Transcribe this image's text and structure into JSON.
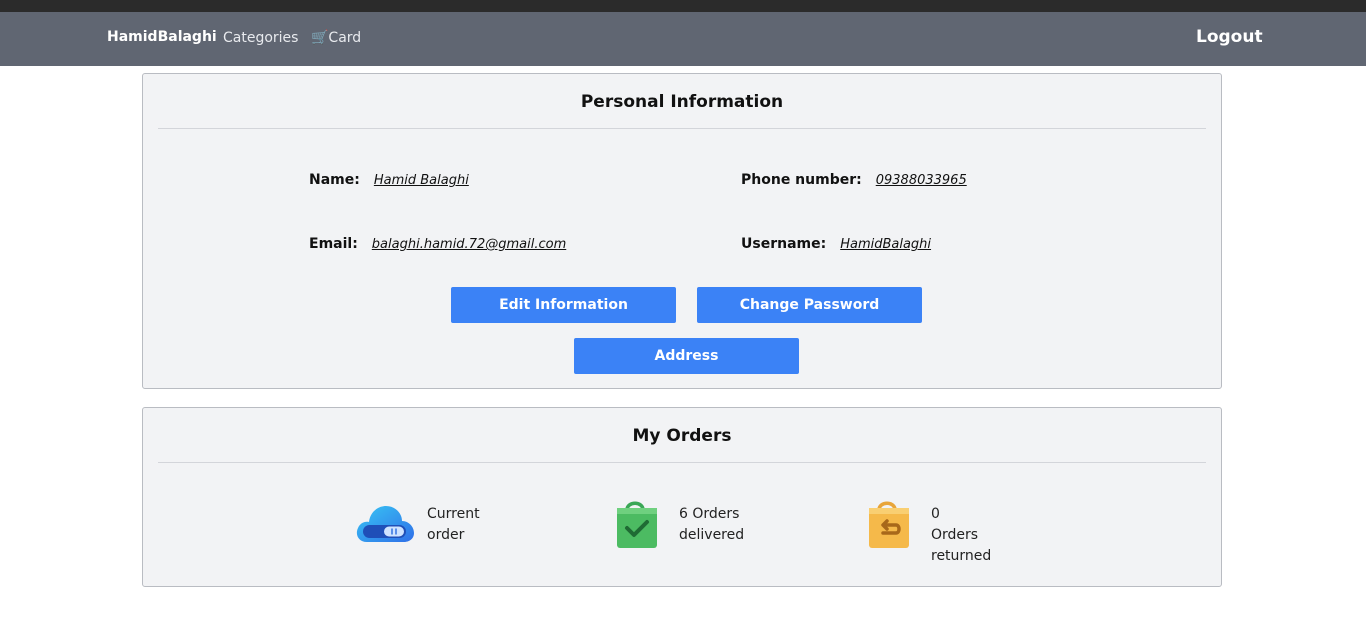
{
  "navbar": {
    "brand": "HamidBalaghi",
    "categories": "Categories",
    "card": "🛒Card",
    "logout": "Logout"
  },
  "personal": {
    "title": "Personal Information",
    "name_label": "Name:",
    "name_value": "Hamid Balaghi",
    "phone_label": "Phone number:",
    "phone_value": "09388033965",
    "email_label": "Email:",
    "email_value": "balaghi.hamid.72@gmail.com",
    "username_label": "Username:",
    "username_value": "HamidBalaghi",
    "edit_button": "Edit Information",
    "password_button": "Change Password",
    "address_button": "Address"
  },
  "orders": {
    "title": "My Orders",
    "current_line1": "Current",
    "current_line2": "order",
    "delivered_line1": "6 Orders",
    "delivered_line2": "delivered",
    "returned_line1": "0 Orders",
    "returned_line2": "returned",
    "icons": [
      "cloud-toggle-icon",
      "shopping-bag-check-icon",
      "shopping-bag-return-icon"
    ]
  },
  "colors": {
    "navbar": "#606672",
    "button": "#3b82f6",
    "panel": "#f2f3f5"
  }
}
